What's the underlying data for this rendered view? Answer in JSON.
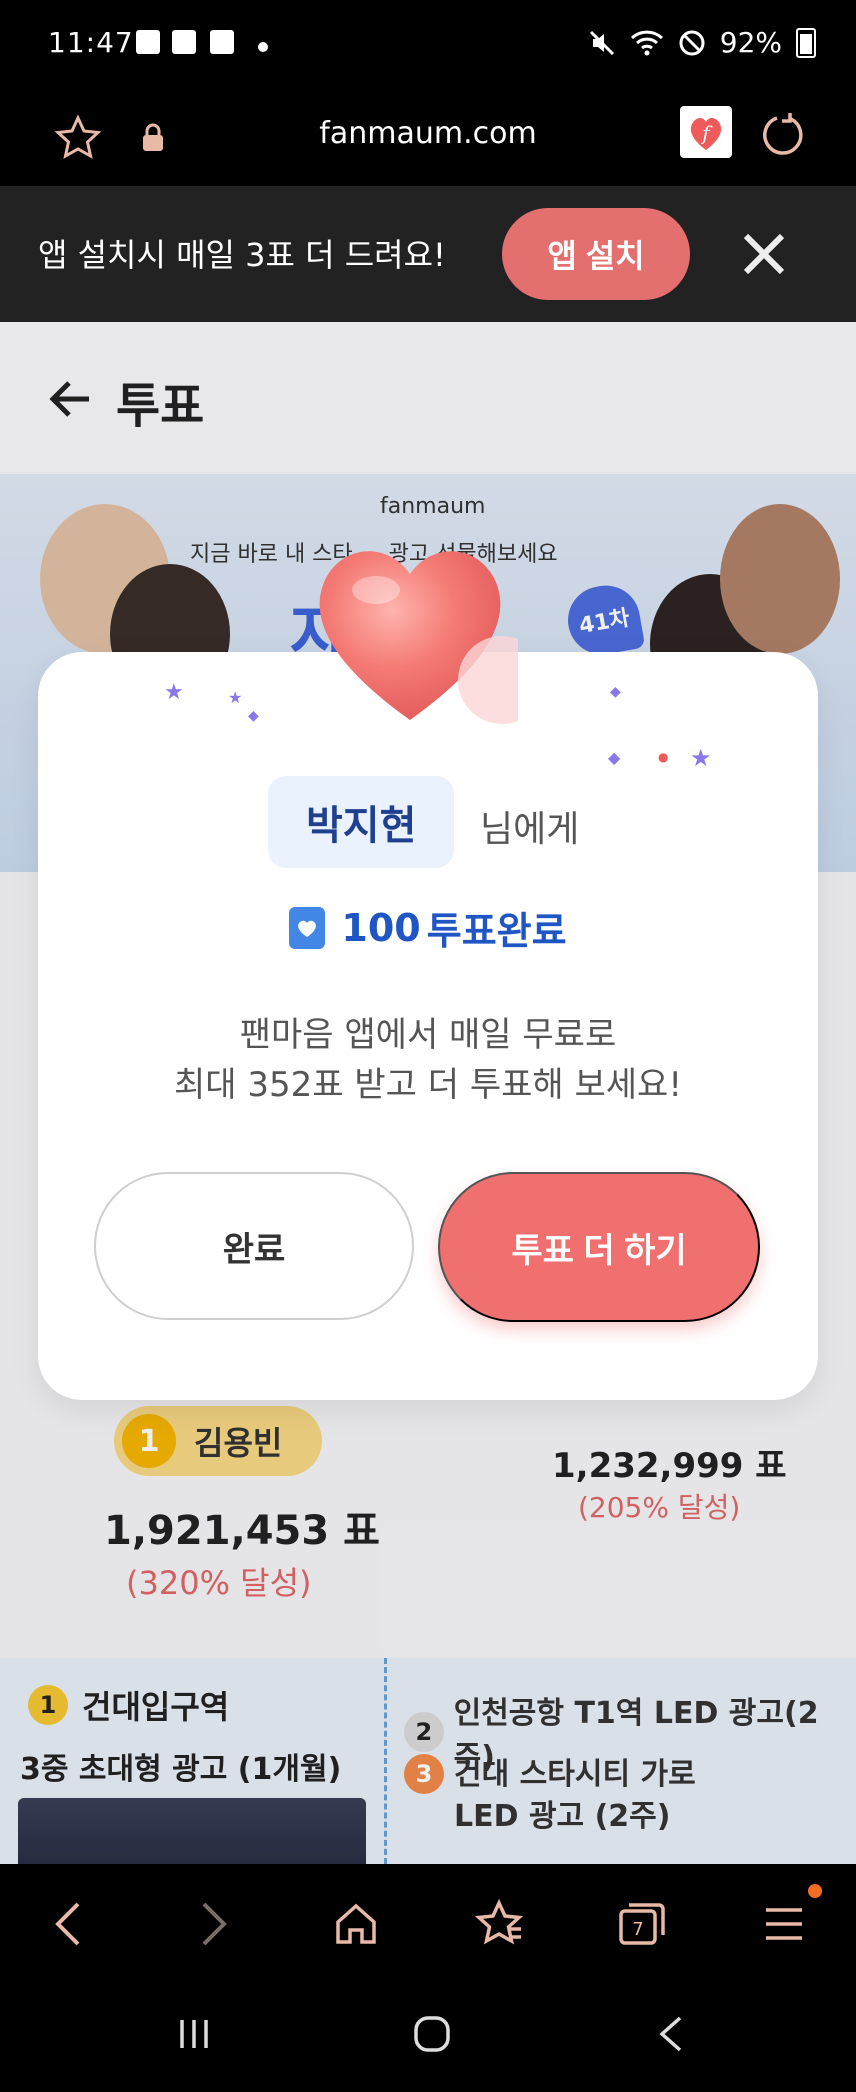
{
  "status_bar": {
    "time": "11:47",
    "battery": "92%"
  },
  "browser": {
    "url": "fanmaum.com",
    "tab_count": "7"
  },
  "install_banner": {
    "text": "앱 설치시 매일 3표 더 드려요!",
    "button": "앱 설치"
  },
  "page": {
    "title": "투표"
  },
  "hero": {
    "brand": "fanmaum",
    "copy": "지금 바로 내 스타 … 광고 선물해보세요",
    "badge": "41차"
  },
  "modal": {
    "recipient": "박지현",
    "recipient_suffix": "님에게",
    "vote_count": "100",
    "vote_label": "투표완료",
    "message_line1": "팬마음 앱에서 매일 무료로",
    "message_line2": "최대 352표 받고 더 투표해 보세요!",
    "done_button": "완료",
    "more_button": "투표 더 하기"
  },
  "ranking": {
    "first": {
      "rank": "1",
      "name": "김용빈",
      "votes": "1,921,453 표",
      "percent": "(320% 달성)"
    },
    "second": {
      "votes": "1,232,999 표",
      "percent": "(205% 달성)"
    }
  },
  "rewards": {
    "first": {
      "rank": "1",
      "title": "건대입구역",
      "subtitle": "3중 초대형 광고 (1개월)"
    },
    "second": {
      "rank": "2",
      "title": "인천공항 T1역 LED 광고(2주)"
    },
    "third": {
      "rank": "3",
      "title_line1": "건대 스타시티 가로",
      "title_line2": "LED 광고 (2주)"
    }
  }
}
